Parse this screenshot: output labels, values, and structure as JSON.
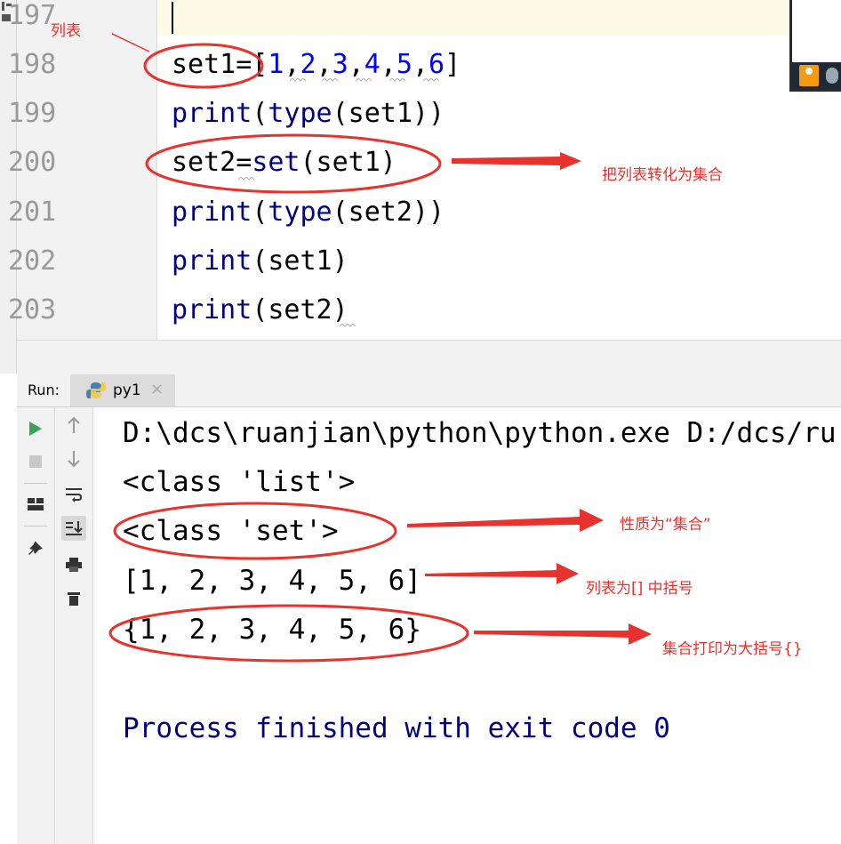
{
  "editor": {
    "lines": [
      {
        "number": "197",
        "code": ""
      },
      {
        "number": "198",
        "code": "set1=[1,2,3,4,5,6]"
      },
      {
        "number": "199",
        "code": "print(type(set1))"
      },
      {
        "number": "200",
        "code": "set2=set(set1)"
      },
      {
        "number": "201",
        "code": "print(type(set2))"
      },
      {
        "number": "202",
        "code": "print(set1)"
      },
      {
        "number": "203",
        "code": "print(set2)"
      }
    ]
  },
  "run_panel": {
    "label": "Run:",
    "tab_label": "py1",
    "tab_close": "×",
    "toolbar_icons": [
      "play-icon",
      "stop-icon",
      "layout-icon",
      "pin-icon",
      "arrow-up-icon",
      "arrow-down-icon",
      "soft-wrap-icon",
      "scroll-to-end-icon",
      "print-icon",
      "trash-icon"
    ]
  },
  "console": {
    "lines": [
      "D:\\dcs\\ruanjian\\python\\python.exe D:/dcs/ru",
      "<class 'list'>",
      "<class 'set'>",
      "[1, 2, 3, 4, 5, 6]",
      "{1, 2, 3, 4, 5, 6}",
      "",
      "Process finished with exit code 0"
    ]
  },
  "annotations": {
    "list_note": "列表",
    "convert_note": "把列表转化为集合",
    "type_note": "性质为“集合”",
    "brackets_note": "列表为[] 中括号",
    "braces_note": "集合打印为大括号{}"
  },
  "colors": {
    "annotation_red": "#e8322d",
    "keyword_navy": "#000080",
    "number_blue": "#0000ff",
    "current_line": "#fdfbe6"
  }
}
